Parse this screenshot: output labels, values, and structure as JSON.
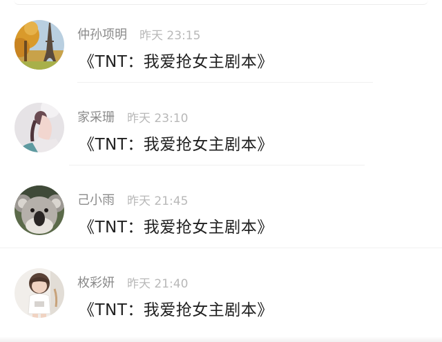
{
  "comments": [
    {
      "name": "仲孙项明",
      "time": "昨天 23:15",
      "text": "《TNT：我爱抢女主剧本》",
      "avatar_icon": "eiffel-tower-autumn-avatar"
    },
    {
      "name": "家采珊",
      "time": "昨天 23:10",
      "text": "《TNT：我爱抢女主剧本》",
      "avatar_icon": "girl-ponytail-avatar"
    },
    {
      "name": "己小雨",
      "time": "昨天 21:45",
      "text": "《TNT：我爱抢女主剧本》",
      "avatar_icon": "koala-avatar"
    },
    {
      "name": "枚彩妍",
      "time": "昨天 21:40",
      "text": "《TNT：我爱抢女主剧本》",
      "avatar_icon": "child-photo-avatar"
    }
  ],
  "colors": {
    "name": "#8a8a8a",
    "time": "#b8b8b8",
    "text": "#1f1f1f",
    "divider": "#f0f0f0"
  }
}
